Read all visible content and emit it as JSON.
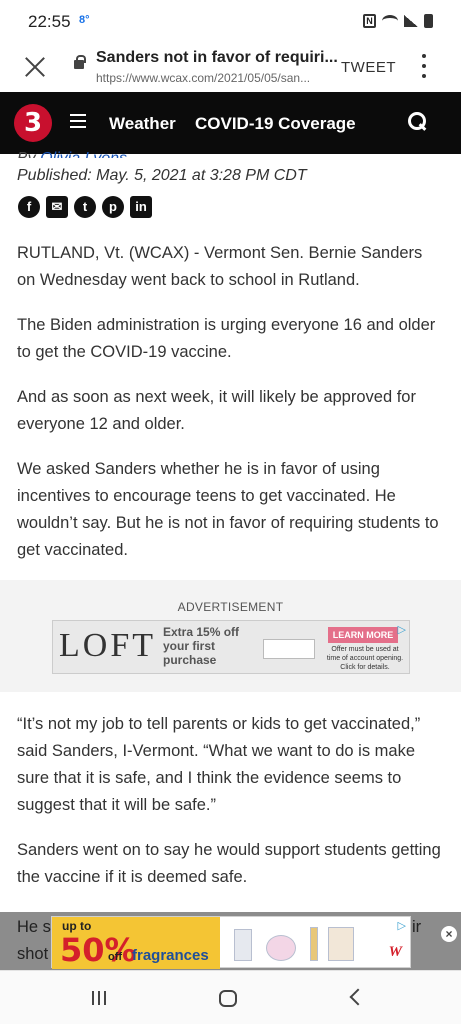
{
  "status_bar": {
    "time": "22:55",
    "temperature": "8°"
  },
  "browser": {
    "page_title": "Sanders not in favor of requiri...",
    "url": "https://www.wcax.com/2021/05/05/san...",
    "tweet_label": "TWEET"
  },
  "site_nav": {
    "logo_text": "3",
    "links": [
      "Weather",
      "COVID-19 Coverage"
    ]
  },
  "article": {
    "byline_prefix": "By",
    "author": "Olivia Lyons",
    "published": "Published: May. 5, 2021 at 3:28 PM CDT",
    "share_icons": [
      "facebook-icon",
      "email-icon",
      "twitter-icon",
      "pinterest-icon",
      "linkedin-icon"
    ],
    "paragraphs": [
      "RUTLAND, Vt. (WCAX) - Vermont Sen. Bernie Sanders on Wednesday went back to school in Rutland.",
      "The Biden administration is urging everyone 16 and older to get the COVID-19 vaccine.",
      "And as soon as next week, it will likely be approved for everyone 12 and older.",
      "We asked Sanders whether he is in favor of using incentives to encourage teens to get vaccinated. He wouldn’t say. But he is not in favor of requiring students to get vaccinated.",
      "“It’s not my job to tell parents or kids to get vaccinated,” said Sanders, I-Vermont. “What we want to do is make sure that it is safe, and I think the evidence seems to suggest that it will be safe.”",
      "Sanders went on to say he would support students getting the vaccine if it is deemed safe."
    ],
    "partial_line_1_left": "He s",
    "partial_line_1_right": "ir",
    "partial_line_2_left": "shot"
  },
  "advertisement": {
    "label": "ADVERTISEMENT",
    "brand": "LOFT",
    "offer_line1": "Extra 15% off",
    "offer_line2": "your first",
    "offer_line3": "purchase",
    "cta": "LEARN MORE",
    "fine_print": "Offer must be used at time of account opening. Click for details."
  },
  "sticky_ad": {
    "up_to": "up to",
    "percent": "50%",
    "off": "off",
    "category": "fragrances",
    "brand": "W"
  },
  "colors": {
    "nav_background": "#0b0b0b",
    "logo_red": "#c8102e",
    "link_blue": "#1a56b8",
    "promo_yellow": "#f4c534",
    "promo_red": "#d4202b"
  }
}
